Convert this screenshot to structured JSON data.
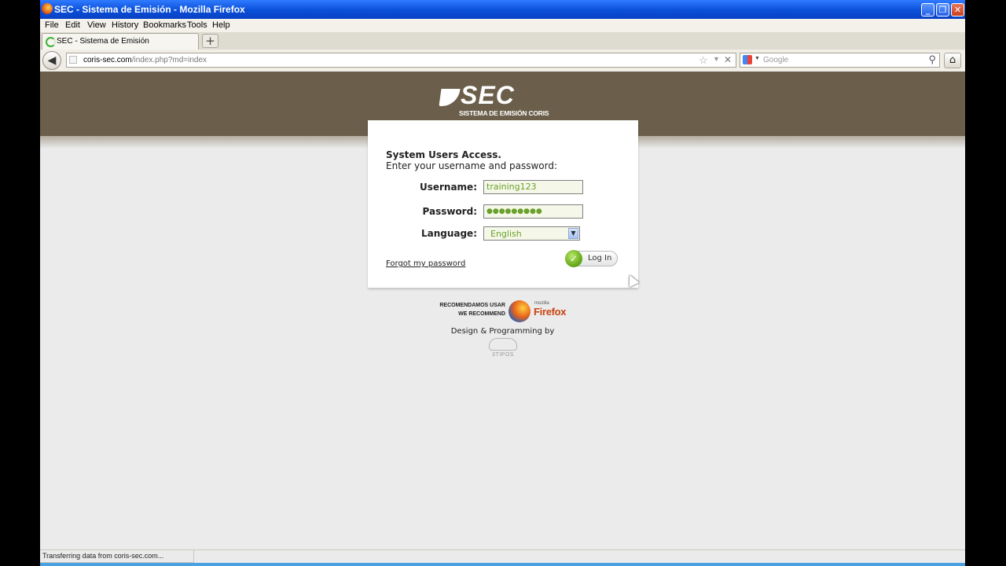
{
  "window": {
    "title": "SEC - Sistema de Emisión - Mozilla Firefox"
  },
  "menu": [
    "File",
    "Edit",
    "View",
    "History",
    "Bookmarks",
    "Tools",
    "Help"
  ],
  "tab": {
    "label": "SEC - Sistema de Emisión",
    "new_tab": "+"
  },
  "nav": {
    "url_host": "coris-sec.com",
    "url_path": "/index.php?md=index",
    "search_placeholder": "Google"
  },
  "logo": {
    "word": "SEC",
    "subtitle": "SISTEMA DE EMISIÓN CORIS"
  },
  "login": {
    "heading": "System Users Access.",
    "subheading": "Enter your username and password:",
    "username_label": "Username:",
    "username_value": "training123",
    "password_label": "Password:",
    "password_value": "●●●●●●●●●",
    "language_label": "Language:",
    "language_value": "English",
    "forgot": "Forgot my password",
    "submit": "Log In"
  },
  "recommend": {
    "line1": "RECOMENDAMOS USAR",
    "line2": "WE RECOMMEND",
    "mozilla": "mozilla",
    "firefox": "Firefox"
  },
  "footer": {
    "design": "Design & Programming by",
    "brand": "3TIPOS"
  },
  "status": {
    "text": "Transferring data from coris-sec.com..."
  },
  "colors": {
    "header_band": "#6b5e4b",
    "field_text": "#6aa02c",
    "titlebar": "#0a4fd8"
  }
}
